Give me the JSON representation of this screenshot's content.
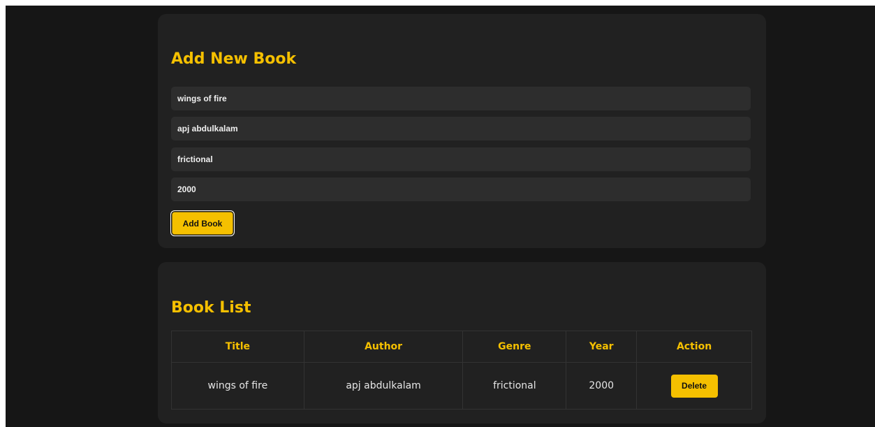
{
  "form": {
    "heading": "Add New Book",
    "fields": [
      {
        "name": "title",
        "value": "wings of fire"
      },
      {
        "name": "author",
        "value": "apj abdulkalam"
      },
      {
        "name": "genre",
        "value": "frictional"
      },
      {
        "name": "year",
        "value": "2000"
      }
    ],
    "submit_label": "Add Book"
  },
  "list": {
    "heading": "Book List",
    "columns": [
      "Title",
      "Author",
      "Genre",
      "Year",
      "Action"
    ],
    "rows": [
      {
        "title": "wings of fire",
        "author": "apj abdulkalam",
        "genre": "frictional",
        "year": "2000",
        "action": "Delete"
      }
    ]
  },
  "colors": {
    "accent": "#f5c000",
    "background": "#161616",
    "card": "#212121",
    "input": "#2d2d2d"
  }
}
